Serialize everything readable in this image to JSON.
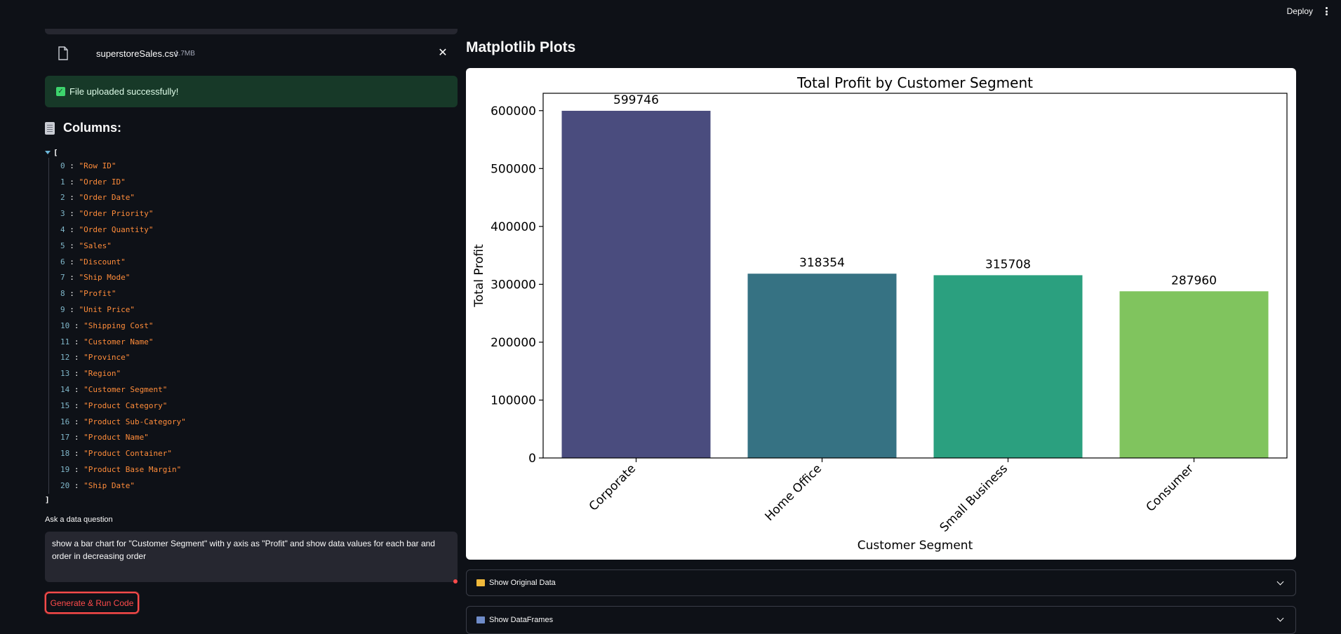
{
  "header": {
    "deploy_label": "Deploy"
  },
  "uploader": {
    "file_name": "superstoreSales.csv",
    "file_size": "1.7MB"
  },
  "success_message": "File uploaded successfully!",
  "columns": {
    "title": "Columns:",
    "open_bracket": "[",
    "close_bracket": "]",
    "items": [
      "\"Row ID\"",
      "\"Order ID\"",
      "\"Order Date\"",
      "\"Order Priority\"",
      "\"Order Quantity\"",
      "\"Sales\"",
      "\"Discount\"",
      "\"Ship Mode\"",
      "\"Profit\"",
      "\"Unit Price\"",
      "\"Shipping Cost\"",
      "\"Customer Name\"",
      "\"Province\"",
      "\"Region\"",
      "\"Customer Segment\"",
      "\"Product Category\"",
      "\"Product Sub-Category\"",
      "\"Product Name\"",
      "\"Product Container\"",
      "\"Product Base Margin\"",
      "\"Ship Date\""
    ]
  },
  "question": {
    "label": "Ask a data question",
    "value": "show a bar chart for \"Customer Segment\" with y axis as \"Profit\" and show data values for each bar and order in decreasing order"
  },
  "generate_button": "Generate & Run Code",
  "plots": {
    "section_title": "Matplotlib Plots"
  },
  "chart_data": {
    "type": "bar",
    "title": "Total Profit by Customer Segment",
    "xlabel": "Customer Segment",
    "ylabel": "Total Profit",
    "categories": [
      "Corporate",
      "Home Office",
      "Small Business",
      "Consumer"
    ],
    "values": [
      599746,
      318354,
      315708,
      287960
    ],
    "colors": [
      "#4a4c7e",
      "#367283",
      "#2ba07f",
      "#80c45e"
    ],
    "ylim": [
      0,
      630000
    ],
    "yticks": [
      0,
      100000,
      200000,
      300000,
      400000,
      500000,
      600000
    ],
    "grid": false,
    "legend": "none"
  },
  "expanders": [
    {
      "label": "Show Original Data"
    },
    {
      "label": "Show DataFrames"
    }
  ]
}
